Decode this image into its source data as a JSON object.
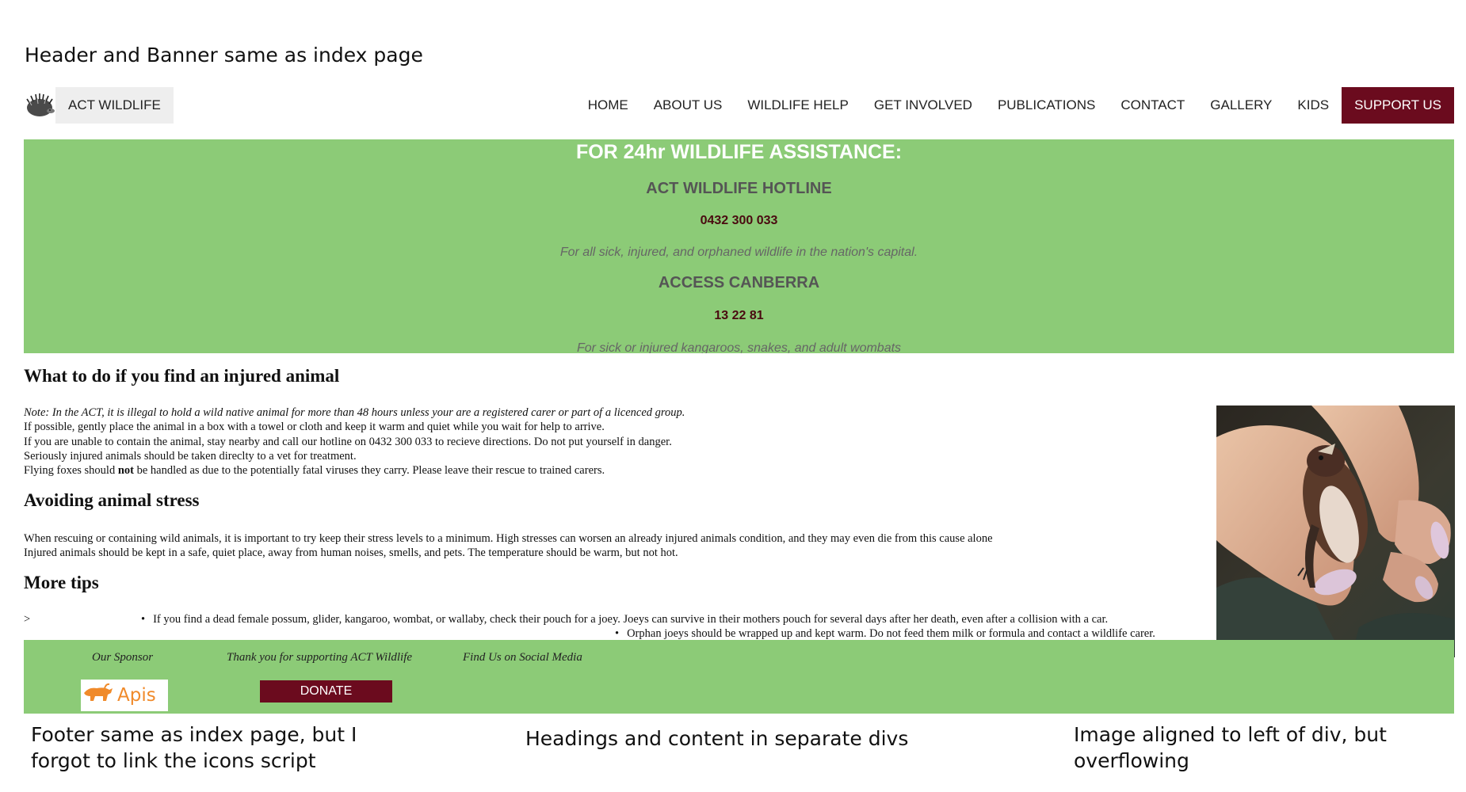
{
  "annotations": {
    "top": "Header and Banner same as index page",
    "footer": "Footer same as index page, but I forgot to link the icons script",
    "divs": "Headings and content in separate divs",
    "image": "Image aligned to left of div, but overflowing"
  },
  "header": {
    "brand": "ACT WILDLIFE",
    "logo_icon": "echidna-logo",
    "nav": [
      "HOME",
      "ABOUT US",
      "WILDLIFE HELP",
      "GET INVOLVED",
      "PUBLICATIONS",
      "CONTACT",
      "GALLERY",
      "KIDS"
    ],
    "support": "SUPPORT US"
  },
  "banner": {
    "title": "FOR 24hr WILDLIFE ASSISTANCE:",
    "hotline_heading": "ACT WILDLIFE HOTLINE",
    "hotline_phone": "0432 300 033",
    "hotline_note": "For all sick, injured, and orphaned wildlife in the nation's capital.",
    "access_heading": "ACCESS CANBERRA",
    "access_phone": "13 22 81",
    "access_note": "For sick or injured kangaroos, snakes, and adult wombats"
  },
  "content": {
    "section1": {
      "heading": "What to do if you find an injured animal",
      "note": "Note: In the ACT, it is illegal to hold a wild native animal for more than 48 hours unless your are a registered carer or part of a licenced group.",
      "lines": [
        "If possible, gently place the animal in a box with a towel or cloth and keep it warm and quiet while you wait for help to arrive.",
        "If you are unable to contain the animal, stay nearby and call our hotline on 0432 300 033 to recieve directions. Do not put yourself in danger.",
        "Seriously injured animals should be taken direclty to a vet for treatment."
      ],
      "flying_pre": "Flying foxes should ",
      "flying_bold": "not",
      "flying_post": " be handled as due to the potentially fatal viruses they carry. Please leave their rescue to trained carers."
    },
    "section2": {
      "heading": "Avoiding animal stress",
      "lines": [
        "When rescuing or containing wild animals, it is important to try keep their stress levels to a minimum. High stresses can worsen an already injured animals condition, and they may even die from this cause alone",
        "Injured animals should be kept in a safe, quiet place, away from human noises, smells, and pets. The temperature should be warm, but not hot."
      ]
    },
    "section3": {
      "heading": "More tips",
      "arrow": ">",
      "tips": [
        "If you find a dead female possum, glider, kangaroo, wombat, or wallaby, check their pouch for a joey. Joeys can survive in their mothers pouch for several days after her death, even after a collision with a car.",
        "Orphan joeys should be wrapped up and kept warm. Do not feed them milk or formula and contact a wildlife carer."
      ]
    }
  },
  "footer": {
    "sponsor_label": "Our Sponsor",
    "thanks_label": "Thank you for supporting ACT Wildlife",
    "social_label": "Find Us on Social Media",
    "sponsor_name": "Apis",
    "donate": "DONATE"
  },
  "colors": {
    "green": "#8ccb77",
    "maroon": "#6b0b1e",
    "apis_orange": "#f08a2a"
  }
}
